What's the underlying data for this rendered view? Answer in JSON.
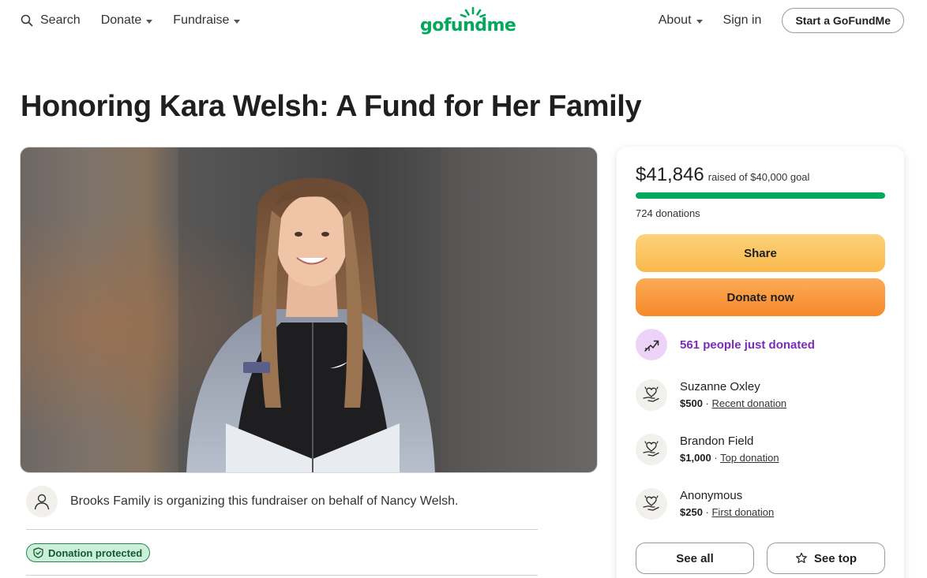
{
  "header": {
    "search_label": "Search",
    "donate_label": "Donate",
    "fundraise_label": "Fundraise",
    "logo_text": "gofundme",
    "about_label": "About",
    "signin_label": "Sign in",
    "start_label": "Start a GoFundMe"
  },
  "campaign": {
    "title": "Honoring Kara Welsh: A Fund for Her Family",
    "organizer_text": "Brooks Family is organizing this fundraiser on behalf of Nancy Welsh.",
    "protected_label": "Donation protected"
  },
  "donation_card": {
    "raised_amount": "$41,846",
    "goal_text": "raised of $40,000 goal",
    "progress_fraction": 1.0,
    "donations_count": "724 donations",
    "share_label": "Share",
    "donate_label": "Donate now",
    "trend_text": "561 people just donated",
    "donors": [
      {
        "name": "Suzanne Oxley",
        "amount": "$500",
        "separator": " · ",
        "tag": "Recent donation"
      },
      {
        "name": "Brandon Field",
        "amount": "$1,000",
        "separator": " · ",
        "tag": "Top donation"
      },
      {
        "name": "Anonymous",
        "amount": "$250",
        "separator": " · ",
        "tag": "First donation"
      }
    ],
    "see_all_label": "See all",
    "see_top_label": "See top"
  },
  "colors": {
    "brand_green": "#02a95c",
    "share_yellow": "#f9b94c",
    "donate_orange": "#f6892a",
    "trend_purple": "#7a2cb8"
  },
  "icons": [
    "search-icon",
    "caret-down-icon",
    "sprout-logo-icon",
    "user-icon",
    "shield-check-icon",
    "trending-up-icon",
    "heart-hand-icon",
    "star-icon"
  ]
}
